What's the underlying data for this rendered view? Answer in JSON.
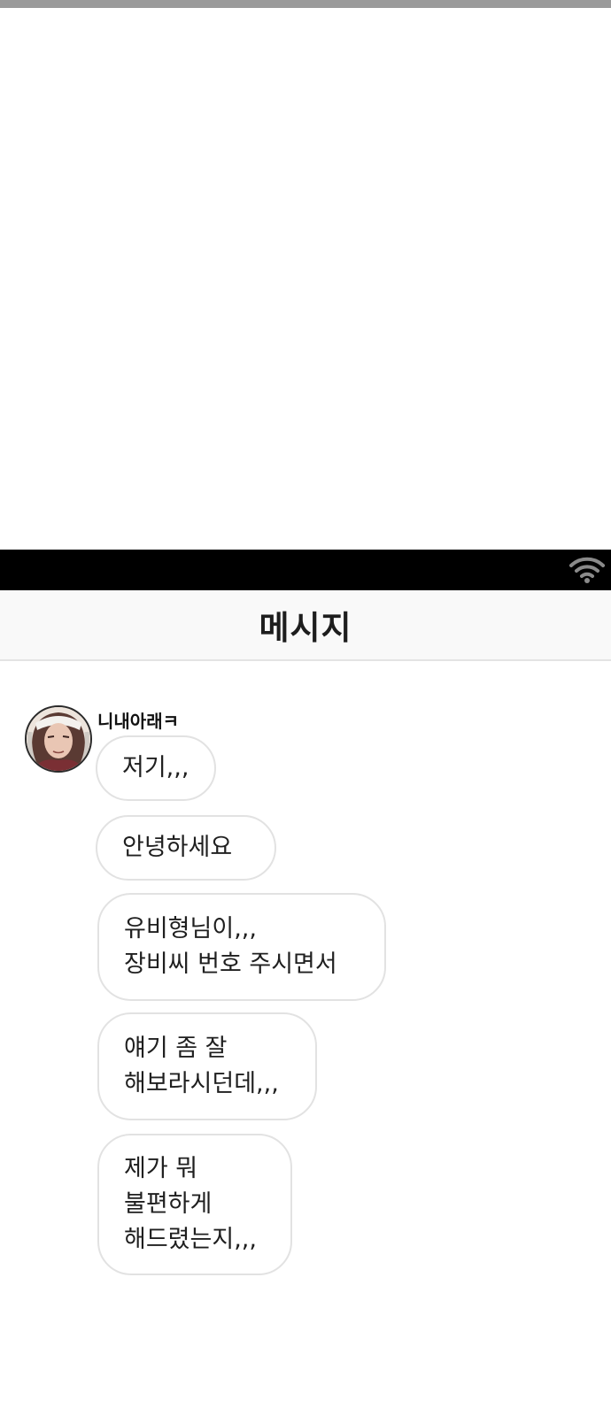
{
  "header": {
    "title": "메시지"
  },
  "status_bar": {
    "icons": [
      "wifi-icon"
    ]
  },
  "conversation": {
    "sender_name": "니내아래ㅋ",
    "avatar": "avatar-portrait",
    "messages": [
      {
        "lines": [
          "저기,,,"
        ]
      },
      {
        "lines": [
          "안녕하세요"
        ]
      },
      {
        "lines": [
          "유비형님이,,,",
          "장비씨 번호 주시면서"
        ]
      },
      {
        "lines": [
          "얘기 좀 잘",
          "해보라시던데,,,"
        ]
      },
      {
        "lines": [
          "제가 뭐",
          "불편하게",
          "해드렸는지,,,"
        ]
      }
    ]
  },
  "colors": {
    "status_bar": "#000000",
    "header_background": "#f9f9f9",
    "bubble_border": "#e2e2e2",
    "top_strip": "#9a9a9a"
  }
}
